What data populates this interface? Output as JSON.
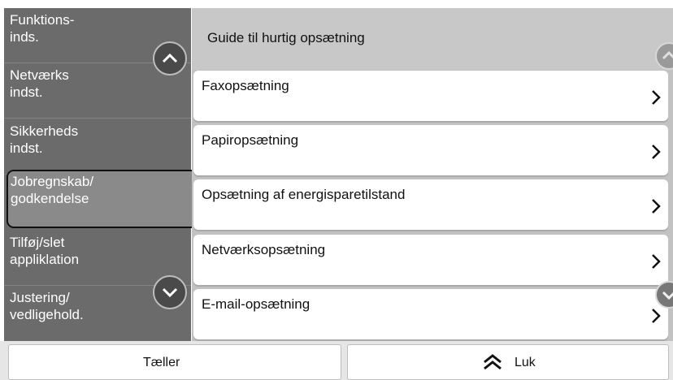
{
  "sidebar": {
    "items": [
      {
        "line1": "Funktions-",
        "line2": "inds."
      },
      {
        "line1": "Netværks",
        "line2": "indst."
      },
      {
        "line1": "Sikkerheds",
        "line2": "indst."
      },
      {
        "line1": "Jobregnskab/",
        "line2": "godkendelse"
      },
      {
        "line1": "Tilføj/slet",
        "line2": "appliklation"
      },
      {
        "line1": "Justering/",
        "line2": "vedligehold."
      }
    ]
  },
  "main": {
    "title": "Guide til hurtig opsætning",
    "items": [
      {
        "label": "Faxopsætning"
      },
      {
        "label": "Papiropsætning"
      },
      {
        "label": "Opsætning af energisparetilstand"
      },
      {
        "label": "Netværksopsætning"
      },
      {
        "label": "E-mail-opsætning"
      }
    ]
  },
  "bottom": {
    "counter_label": "Tæller",
    "close_label": "Luk"
  },
  "icons": {
    "scroll_up": "chevron-up-icon",
    "scroll_down": "chevron-down-icon",
    "item_arrow": "chevron-right-icon",
    "close": "double-chevron-up-icon"
  },
  "colors": {
    "sidebar_bg": "#6b6b6b",
    "list_bg": "#c2c2c2",
    "selected_border": "#111111"
  }
}
